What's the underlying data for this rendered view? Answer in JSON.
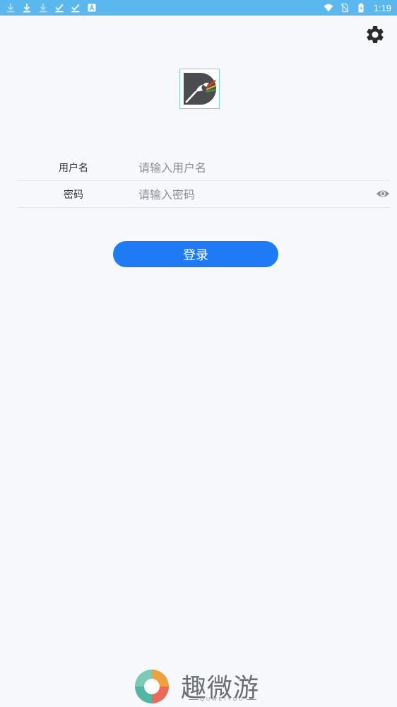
{
  "status_bar": {
    "time": "1:19",
    "left_icons": [
      "download-icon",
      "download-icon",
      "download-icon",
      "check-icon",
      "check-icon",
      "app-icon"
    ],
    "right_icons": [
      "wifi-icon",
      "no-sim-icon",
      "battery-icon"
    ]
  },
  "header": {
    "settings_icon": "gear-icon"
  },
  "form": {
    "username": {
      "label": "用户名",
      "placeholder": "请输入用户名",
      "value": ""
    },
    "password": {
      "label": "密码",
      "placeholder": "请输入密码",
      "value": "",
      "toggle_icon": "eye-icon"
    }
  },
  "login_button": {
    "label": "登录"
  },
  "footer": {
    "brand_name": "趣微游",
    "brand_sub": "QUWEIYOU"
  },
  "colors": {
    "status_bar": "#5ab8ef",
    "background": "#f6f8fc",
    "primary": "#1f7bf4",
    "divider": "#e4e7ec"
  }
}
